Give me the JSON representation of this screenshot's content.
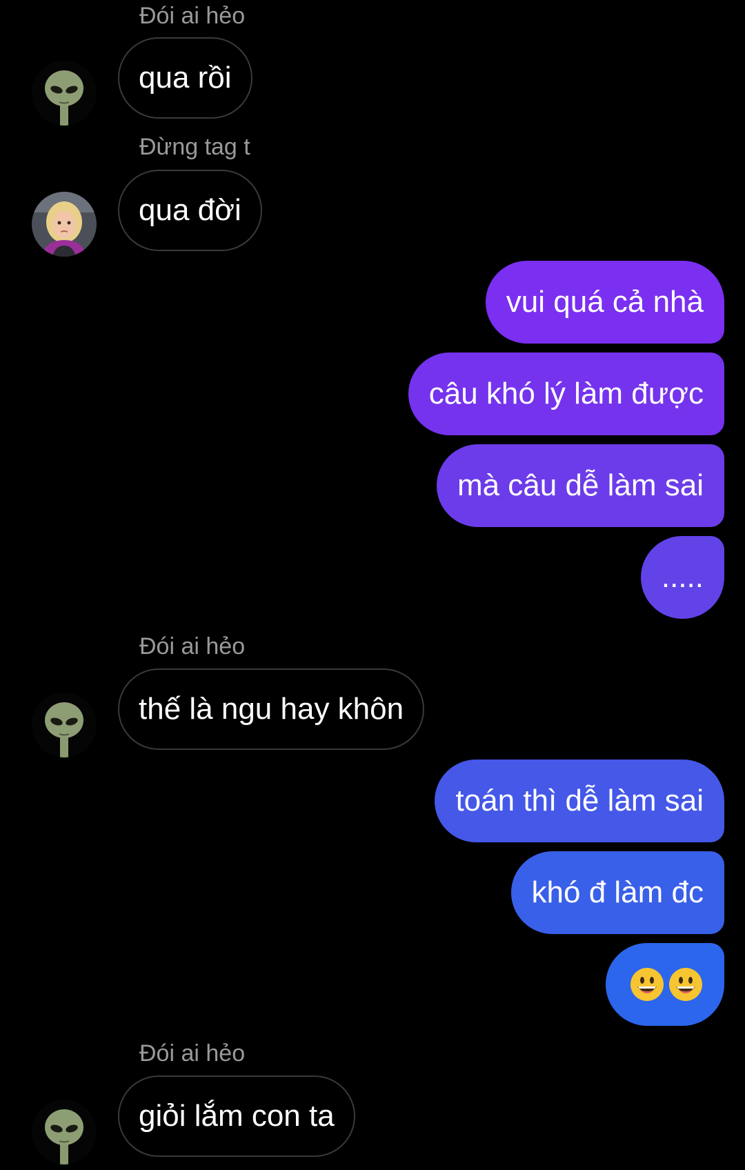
{
  "messages": [
    {
      "type": "incoming",
      "sender": "Đói ai hẻo",
      "avatar": "alien-avatar",
      "text": "qua rồi"
    },
    {
      "type": "incoming",
      "sender": "Đừng tag t",
      "avatar": "girl-avatar",
      "text": "qua đời"
    },
    {
      "type": "outgoing",
      "text": "vui quá cả nhà",
      "color": "#7b2ff0"
    },
    {
      "type": "outgoing",
      "text": "câu khó lý làm được",
      "color": "#7533ee"
    },
    {
      "type": "outgoing",
      "text": "mà câu dễ làm sai",
      "color": "#6c3cea"
    },
    {
      "type": "outgoing",
      "text": ".....",
      "color": "#6243e8"
    },
    {
      "type": "incoming",
      "sender": "Đói ai hẻo",
      "avatar": "alien-avatar",
      "text": "thế là ngu hay khôn"
    },
    {
      "type": "outgoing",
      "text": "toán thì dễ làm sai",
      "color": "#4558e8"
    },
    {
      "type": "outgoing",
      "text": "khó đ làm đc",
      "color": "#3960e9"
    },
    {
      "type": "outgoing",
      "text": "",
      "emoji": [
        "grinning-face-icon",
        "grinning-face-icon"
      ],
      "color": "#2b66ec"
    },
    {
      "type": "incoming",
      "sender": "Đói ai hẻo",
      "avatar": "alien-avatar",
      "text": "giỏi lắm con ta"
    }
  ],
  "colors": {
    "background": "#000000",
    "sender_name": "#9a9a9a",
    "incoming_border": "#3a3a3a",
    "outgoing_gradient": [
      "#7b2ff0",
      "#2b66ec"
    ]
  }
}
